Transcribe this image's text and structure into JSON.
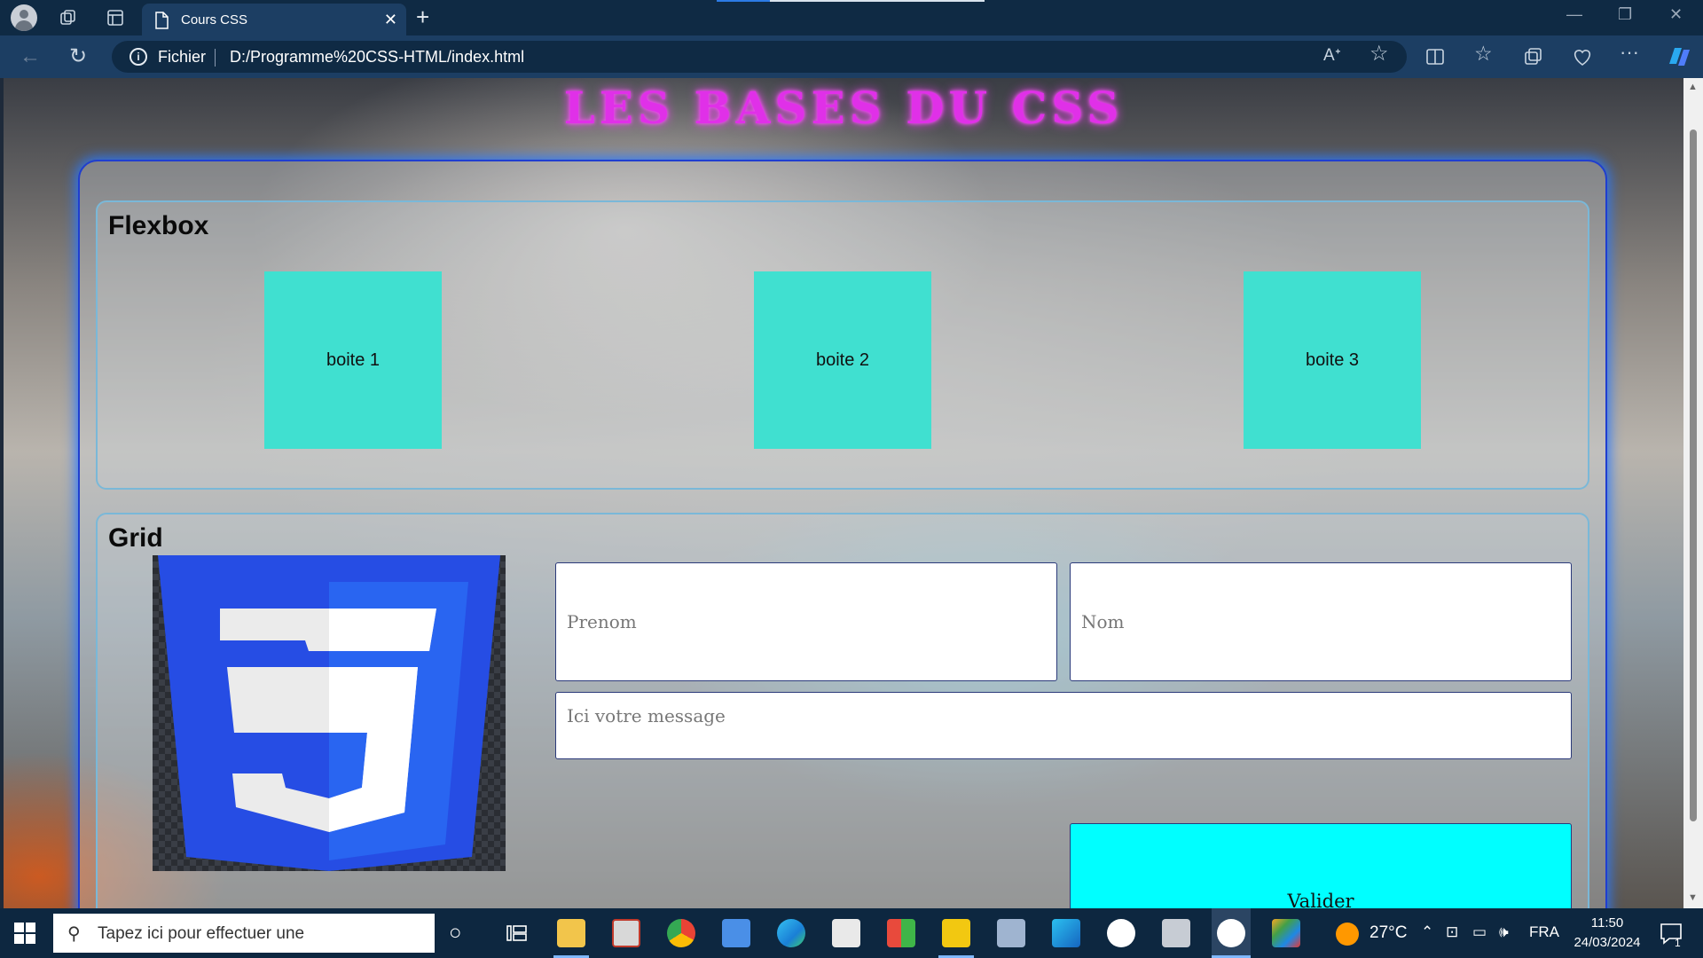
{
  "browser": {
    "tab_title": "Cours CSS",
    "tab_close": "✕",
    "new_tab": "+",
    "address_label": "Fichier",
    "url": "D:/Programme%20CSS-HTML/index.html",
    "window_controls": [
      "—",
      "❐",
      "✕"
    ]
  },
  "page": {
    "title": "LES BASES DU CSS",
    "flexbox": {
      "heading": "Flexbox",
      "boxes": [
        "boite 1",
        "boite 2",
        "boite 3"
      ]
    },
    "grid": {
      "heading": "Grid",
      "logo": "css3-logo",
      "form": {
        "prenom_placeholder": "Prenom",
        "nom_placeholder": "Nom",
        "message_placeholder": "Ici votre message",
        "submit_label": "Valider"
      }
    }
  },
  "taskbar": {
    "search_placeholder": "Tapez ici pour effectuer une",
    "temperature": "27°C",
    "language": "FRA",
    "time": "11:50",
    "date": "24/03/2024",
    "notification_count": "1"
  },
  "colors": {
    "title_magenta": "#e030e8",
    "flex_box": "#40e0d0",
    "submit_button": "#00ffff",
    "css3_blue": "#2965f1"
  }
}
